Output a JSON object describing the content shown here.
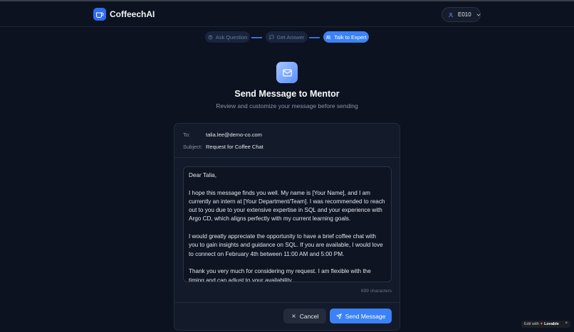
{
  "app": {
    "name": "CoffeechAI"
  },
  "user": {
    "label": "E010"
  },
  "steps": [
    {
      "label": "Ask Question",
      "state": "complete"
    },
    {
      "label": "Get Answer",
      "state": "complete"
    },
    {
      "label": "Talk to Expert",
      "state": "active"
    }
  ],
  "page": {
    "title": "Send Message to Mentor",
    "subtitle": "Review and customize your message before sending"
  },
  "email": {
    "to_label": "To:",
    "to_value": "talia.lee@demo-co.com",
    "subject_label": "Subject:",
    "subject_value": "Request for Coffee Chat",
    "body": [
      "Dear Talia,",
      "I hope this message finds you well. My name is [Your Name], and I am currently an intern at [Your Department/Team]. I was recommended to reach out to you due to your extensive expertise in SQL and your experience with Argo CD, which aligns perfectly with my current learning goals.",
      "I would greatly appreciate the opportunity to have a brief coffee chat with you to gain insights and guidance on SQL. If you are available, I would love to connect on February 4th between 11:00 AM and 5:00 PM.",
      "Thank you very much for considering my request. I am flexible with the timing and can adjust to your availability."
    ],
    "char_count": "699 characters"
  },
  "actions": {
    "cancel": "Cancel",
    "send": "Send Message"
  },
  "badge": {
    "prefix": "Edit with",
    "brand": "Lovable",
    "close": "×"
  },
  "colors": {
    "background": "#0c1220",
    "accent": "#3b82f6",
    "card": "#131a29"
  }
}
